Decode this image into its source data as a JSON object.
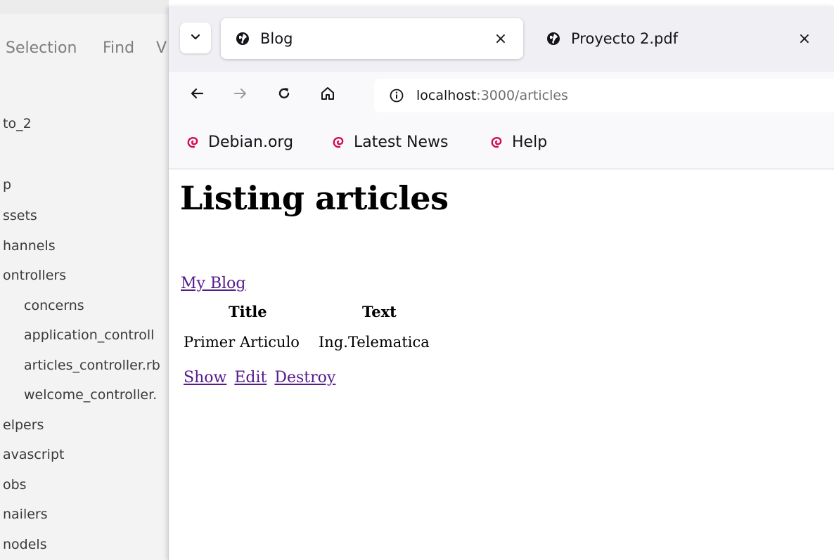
{
  "editor": {
    "menu": [
      "Selection",
      "Find",
      "V"
    ],
    "tree": [
      "to_2",
      "p",
      "ssets",
      "hannels",
      "ontrollers",
      "concerns",
      "application_controll",
      "articles_controller.rb",
      "welcome_controller.",
      "elpers",
      "avascript",
      "obs",
      "nailers",
      "nodels"
    ]
  },
  "browser": {
    "tabs": [
      {
        "title": "Blog",
        "active": true
      },
      {
        "title": "Proyecto 2.pdf",
        "active": false
      }
    ],
    "tab_close_glyph": "×",
    "url_host": "localhost",
    "url_path": ":3000/articles",
    "bookmarks": [
      "Debian.org",
      "Latest News",
      "Help"
    ],
    "colors": {
      "debian_swirl": "#d70a53",
      "link": "#551a8b"
    }
  },
  "page": {
    "heading": "Listing articles",
    "my_blog_link": "My Blog",
    "table": {
      "headers": [
        "Title",
        "Text"
      ],
      "rows": [
        [
          "Primer Articulo",
          "Ing.Telematica"
        ]
      ]
    },
    "actions": [
      "Show",
      "Edit",
      "Destroy"
    ]
  }
}
